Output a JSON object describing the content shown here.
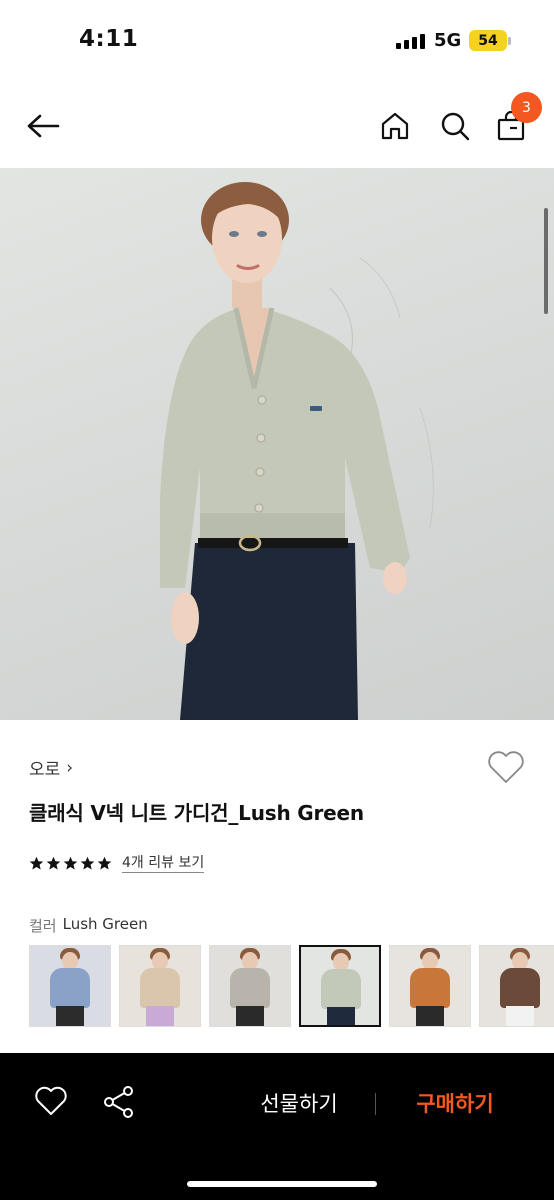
{
  "status_bar": {
    "time": "4:11",
    "network": "5G",
    "battery": "54"
  },
  "header": {
    "back_icon": "arrow-left-icon",
    "home_icon": "home-icon",
    "search_icon": "search-icon",
    "cart_icon": "shopping-bag-icon",
    "cart_badge": "3",
    "badge_color": "#f2581f"
  },
  "product": {
    "image_alt": "Model wearing light sage green V-neck cardigan with dark jeans",
    "brand": "오로",
    "brand_chevron": "›",
    "name": "클래식 V넥 니트 가디건_Lush Green",
    "rating_stars": 5,
    "review_link": "4개 리뷰 보기",
    "color_label": "컬러",
    "color_value": "Lush Green",
    "swatches": [
      {
        "name": "blue",
        "top": "#8aa2c8",
        "bottom": "#2c2c2c",
        "bg": "#d9dde3"
      },
      {
        "name": "beige",
        "top": "#d9c6ad",
        "bottom": "#c9a9d6",
        "bg": "#e7e2dc"
      },
      {
        "name": "gray",
        "top": "#b8b4ac",
        "bottom": "#2a2a2a",
        "bg": "#e0dfdc"
      },
      {
        "name": "lush-green",
        "top": "#c2c9b8",
        "bottom": "#1f2a3d",
        "bg": "#e3e5e3",
        "selected": true
      },
      {
        "name": "orange",
        "top": "#c9763a",
        "bottom": "#2a2a2a",
        "bg": "#e7e4df"
      },
      {
        "name": "brown",
        "top": "#6b4a3a",
        "bottom": "#f2f2f2",
        "bg": "#e6e3df"
      }
    ]
  },
  "bottom_bar": {
    "like_icon": "heart-icon",
    "share_icon": "share-icon",
    "gift_label": "선물하기",
    "buy_label": "구매하기",
    "buy_color": "#f2581f"
  }
}
